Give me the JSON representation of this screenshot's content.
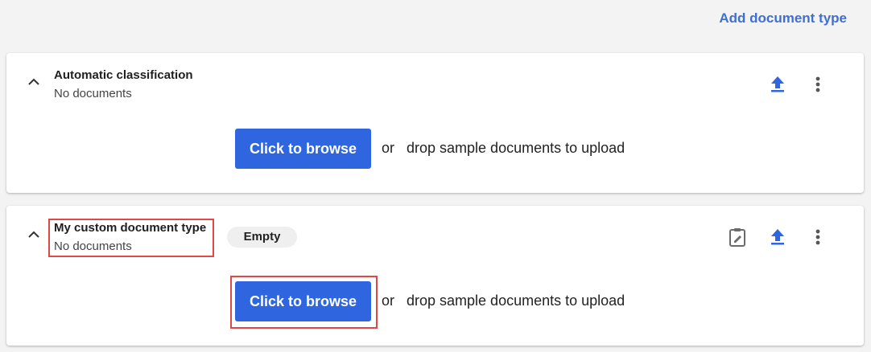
{
  "header": {
    "add_document_type_label": "Add document type"
  },
  "cards": [
    {
      "title": "Automatic classification",
      "subtitle": "No documents",
      "browse_label": "Click to browse",
      "or_label": "or",
      "drop_label": "drop sample documents to upload",
      "icons": [
        "chevron-up-icon",
        "upload-icon",
        "more-vertical-icon"
      ]
    },
    {
      "title": "My custom document type",
      "subtitle": "No documents",
      "status_badge": "Empty",
      "browse_label": "Click to browse",
      "or_label": "or",
      "drop_label": "drop sample documents to upload",
      "icons": [
        "chevron-up-icon",
        "edit-clipboard-icon",
        "upload-icon",
        "more-vertical-icon"
      ]
    }
  ],
  "colors": {
    "accent": "#2f66df",
    "link": "#3f6fd0",
    "highlight": "#e04848",
    "background": "#f3f3f3"
  }
}
